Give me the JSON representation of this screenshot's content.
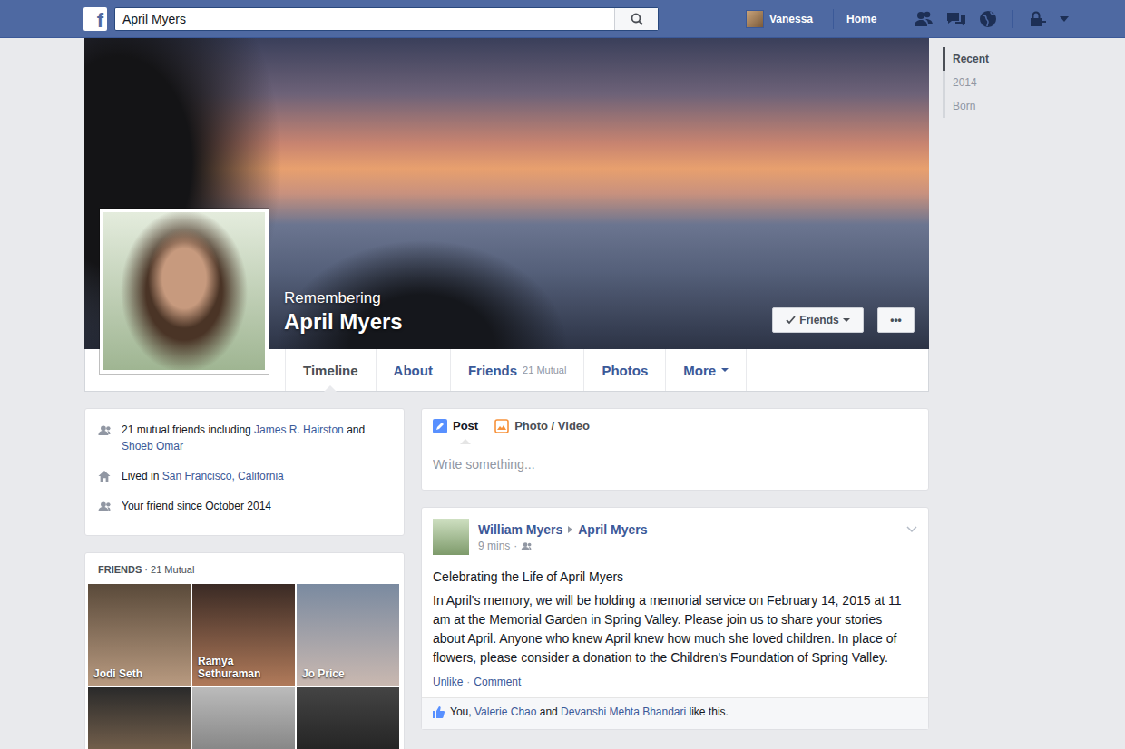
{
  "topbar": {
    "logo": "f",
    "search": {
      "value": "April Myers"
    },
    "user": {
      "name": "Vanessa"
    },
    "home": "Home"
  },
  "profile": {
    "prefix": "Remembering",
    "name": "April Myers",
    "friend_button": {
      "label": "Friends"
    },
    "more_button": {
      "label": "•••"
    }
  },
  "nav_tabs": [
    {
      "label": "Timeline",
      "selected": true
    },
    {
      "label": "About",
      "selected": false
    },
    {
      "label": "Friends",
      "count": "21 Mutual",
      "selected": false
    },
    {
      "label": "Photos",
      "selected": false
    },
    {
      "label": "More",
      "selected": false
    }
  ],
  "timeline_nav": [
    {
      "label": "Recent",
      "selected": true
    },
    {
      "label": "2014",
      "selected": false
    },
    {
      "label": "Born",
      "selected": false
    }
  ],
  "intro": {
    "rows": [
      {
        "kind": "mutual-friends",
        "parts": [
          {
            "text": "21 mutual friends including ",
            "kind": "plain"
          },
          {
            "text": "James R. Hairston",
            "kind": "link"
          },
          {
            "text": " and ",
            "kind": "plain"
          },
          {
            "text": "Shoeb Omar",
            "kind": "link"
          }
        ]
      },
      {
        "kind": "lived",
        "parts": [
          {
            "text": "Lived in ",
            "kind": "plain"
          },
          {
            "text": "San Francisco, California",
            "kind": "link"
          }
        ]
      },
      {
        "kind": "friend-since",
        "parts": [
          {
            "text": "Your friend since October 2014",
            "kind": "plain"
          }
        ]
      }
    ]
  },
  "friends_card": {
    "title": "FRIENDS",
    "separator": "·",
    "count": "21 Mutual",
    "friends": [
      {
        "name": "Jodi Seth"
      },
      {
        "name": "Ramya Sethuraman"
      },
      {
        "name": "Jo Price"
      },
      {},
      {},
      {}
    ]
  },
  "composer": {
    "tabs": [
      {
        "label": "Post",
        "kind": "status",
        "selected": true
      },
      {
        "label": "Photo / Video",
        "kind": "photo",
        "selected": false
      }
    ],
    "placeholder": "Write something..."
  },
  "post": {
    "author": "William Myers",
    "target": "April Myers",
    "time": "9 mins",
    "time_separator": "·",
    "title": "Celebrating the Life of April Myers",
    "body": "In April's memory, we will be holding a memorial service on February 14, 2015 at 11 am at the Memorial Garden in Spring Valley. Please join us to share your stories about April. Anyone who knew April knew how much she loved children. In place of flowers, please consider a donation to the Children's Foundation of Spring Valley.",
    "actions": [
      {
        "label": "Unlike"
      },
      {
        "label": "Comment"
      }
    ],
    "action_separator": "·",
    "liked": true,
    "likes": [
      {
        "text": "You, ",
        "kind": "plain"
      },
      {
        "text": "Valerie Chao",
        "kind": "link"
      },
      {
        "text": " and ",
        "kind": "plain"
      },
      {
        "text": "Devanshi Mehta Bhandari",
        "kind": "link"
      },
      {
        "text": " like this.",
        "kind": "plain"
      }
    ]
  }
}
